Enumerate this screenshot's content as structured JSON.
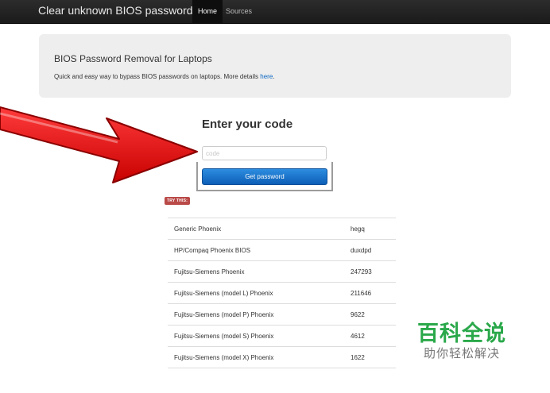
{
  "navbar": {
    "brand": "Clear unknown BIOS passwords",
    "items": [
      "Home",
      "Sources"
    ]
  },
  "hero": {
    "title": "BIOS Password Removal for Laptops",
    "subtitle": "Quick and easy way to bypass BIOS passwords on laptops. More details",
    "link": "here",
    "period": "."
  },
  "form": {
    "heading": "Enter your code",
    "input_value": "",
    "input_placeholder": "code",
    "button_label": "Get password"
  },
  "try_label": "TRY THIS:",
  "table": {
    "rows": [
      {
        "model": "Generic Phoenix",
        "code": "hegq"
      },
      {
        "model": "HP/Compaq Phoenix BIOS",
        "code": "duxdpd"
      },
      {
        "model": "Fujitsu-Siemens Phoenix",
        "code": "247293"
      },
      {
        "model": "Fujitsu-Siemens (model L) Phoenix",
        "code": "211646"
      },
      {
        "model": "Fujitsu-Siemens (model P) Phoenix",
        "code": "9622"
      },
      {
        "model": "Fujitsu-Siemens (model S) Phoenix",
        "code": "4612"
      },
      {
        "model": "Fujitsu-Siemens (model X) Phoenix",
        "code": "1622"
      }
    ]
  },
  "watermark": {
    "main": "百科全说",
    "sub": "助你轻松解决"
  },
  "colors": {
    "navbar": "#1b1b1b",
    "button": "#1a74cc",
    "arrow": "#e01010",
    "watermark": "#2aa84a",
    "badge": "#b94a48"
  }
}
